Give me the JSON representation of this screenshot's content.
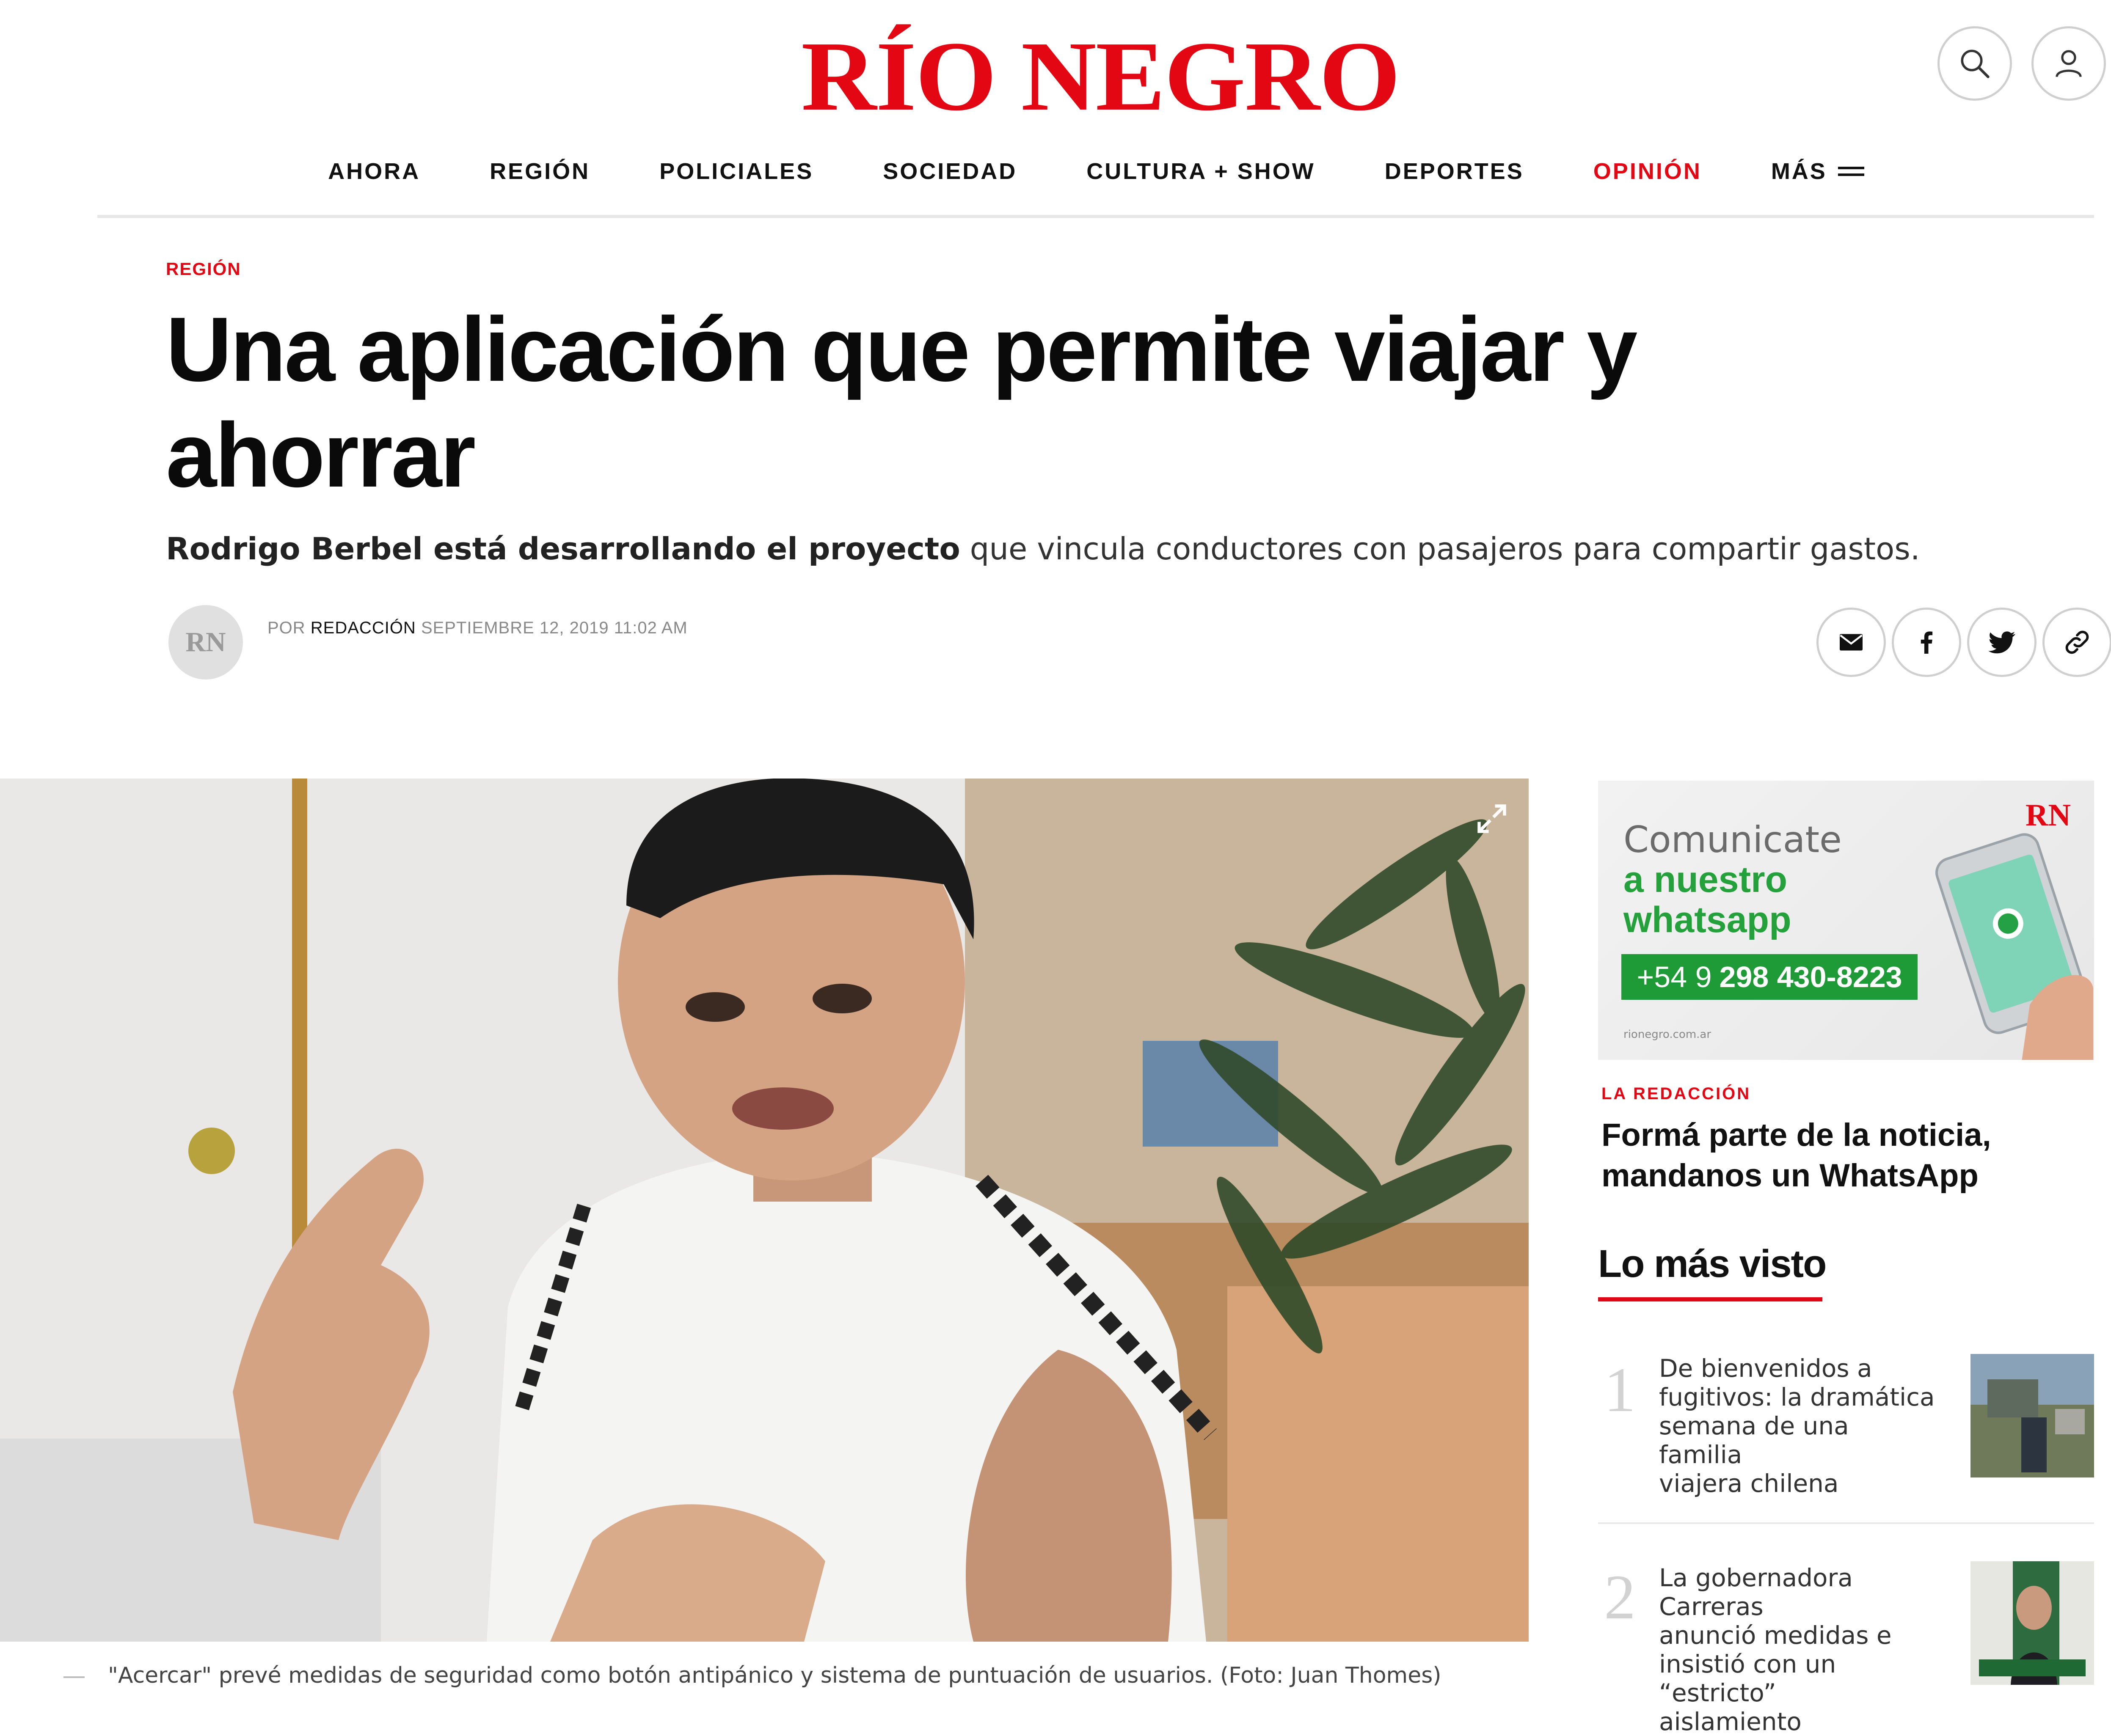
{
  "header": {
    "logo": "RÍO NEGRO",
    "icons": [
      "search-icon",
      "user-icon"
    ]
  },
  "nav": {
    "items": [
      {
        "label": "AHORA"
      },
      {
        "label": "REGIÓN"
      },
      {
        "label": "POLICIALES"
      },
      {
        "label": "SOCIEDAD"
      },
      {
        "label": "CULTURA + SHOW"
      },
      {
        "label": "DEPORTES"
      },
      {
        "label": "OPINIÓN"
      },
      {
        "label": "MÁS"
      }
    ],
    "accent_color": "#e30613"
  },
  "article": {
    "section": "REGIÓN",
    "title_line1": "Una aplicación que permite viajar y",
    "title_line2": "ahorrar",
    "subtitle_bold": "Rodrigo Berbel está desarrollando el proyecto",
    "subtitle_rest": " que vincula conductores con pasajeros para compartir gastos.",
    "avatar_text": "RN",
    "by_prefix": "POR ",
    "author": "REDACCIÓN",
    "date": " SEPTIEMBRE 12, 2019 11:02 AM",
    "share_icons": [
      "mail-icon",
      "facebook-icon",
      "twitter-icon",
      "link-icon"
    ],
    "caption": "\"Acercar\" prevé medidas de seguridad como botón antipánico y sistema de puntuación de usuarios. (Foto: Juan Thomes)"
  },
  "sidebar": {
    "ad": {
      "line1": "Comunicate",
      "line2": "a nuestro",
      "line3": "whatsapp",
      "phone_prefix": "+54 9",
      "phone_number": "298 430-8223",
      "url": "rionegro.com.ar",
      "brand": "RN",
      "brand_color": "#e30613",
      "green": "#24a13a"
    },
    "promo_label": "LA REDACCIÓN",
    "promo_line1": "Formá parte de la noticia,",
    "promo_line2": "mandanos un WhatsApp",
    "most_viewed_title": "Lo más visto",
    "most_viewed": [
      {
        "rank": "1",
        "line1": "De bienvenidos a",
        "line2": "fugitivos: la dramática",
        "line3": "semana de una familia",
        "line4": "viajera chilena"
      },
      {
        "rank": "2",
        "line1": "La gobernadora Carreras",
        "line2": "anunció medidas e",
        "line3": "insistió con un “estricto”",
        "line4": "aislamiento"
      }
    ]
  }
}
